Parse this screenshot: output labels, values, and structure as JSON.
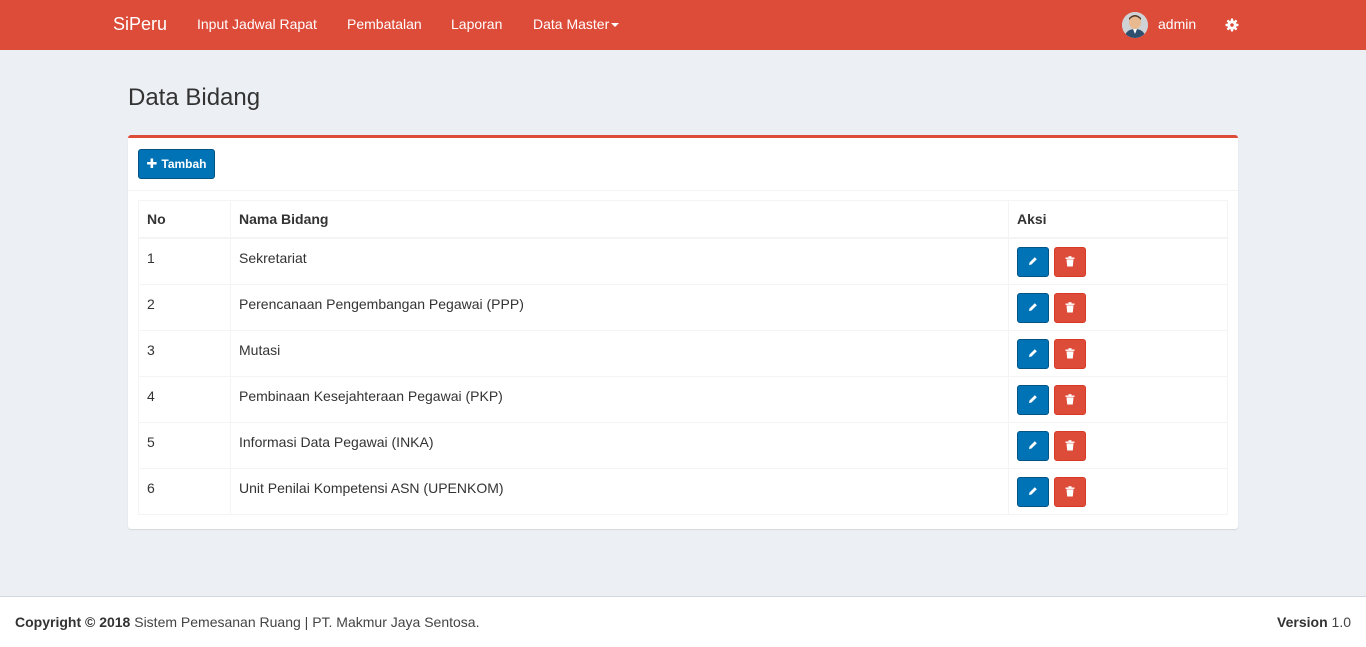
{
  "navbar": {
    "brand": "SiPeru",
    "links": [
      "Input Jadwal Rapat",
      "Pembatalan",
      "Laporan",
      "Data Master"
    ],
    "user": "admin",
    "color": "#dd4b39"
  },
  "page": {
    "title": "Data Bidang"
  },
  "box": {
    "add_button": "Tambah",
    "accent": "#dd4b39"
  },
  "table": {
    "headers": [
      "No",
      "Nama Bidang",
      "Aksi"
    ],
    "rows": [
      {
        "no": "1",
        "nama": "Sekretariat"
      },
      {
        "no": "2",
        "nama": "Perencanaan Pengembangan Pegawai (PPP)"
      },
      {
        "no": "3",
        "nama": "Mutasi"
      },
      {
        "no": "4",
        "nama": "Pembinaan Kesejahteraan Pegawai (PKP)"
      },
      {
        "no": "5",
        "nama": "Informasi Data Pegawai (INKA)"
      },
      {
        "no": "6",
        "nama": "Unit Penilai Kompetensi ASN (UPENKOM)"
      }
    ],
    "action_icons": [
      "pencil-icon",
      "trash-icon"
    ]
  },
  "footer": {
    "copyright_label": "Copyright © 2018",
    "company": "Sistem Pemesanan Ruang | PT. Makmur Jaya Sentosa.",
    "version_label": "Version",
    "version_value": "1.0"
  }
}
